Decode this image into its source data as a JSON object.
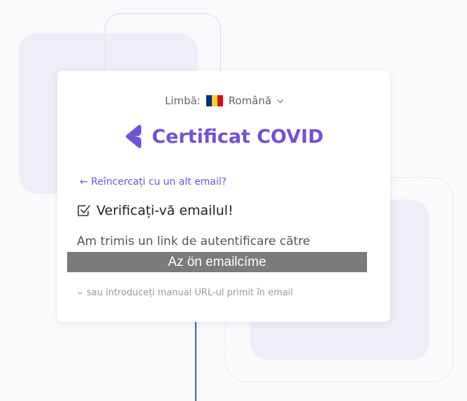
{
  "language": {
    "label": "Limbă:",
    "selected": "Română",
    "flag_colors": [
      "#002b7f",
      "#fcd116",
      "#ce1126"
    ]
  },
  "brand": {
    "title": "Certificat COVID",
    "accent_color": "#6f52d9"
  },
  "back_link": {
    "arrow": "←",
    "text": "Reîncercați cu un alt email?"
  },
  "heading": "Verificați-vă emailul!",
  "message": "Am trimis un link de autentificare către",
  "email_overlay": "Az ön emailcíme",
  "manual_url_toggle": "sau introduceți manual URL-ul primit în email"
}
